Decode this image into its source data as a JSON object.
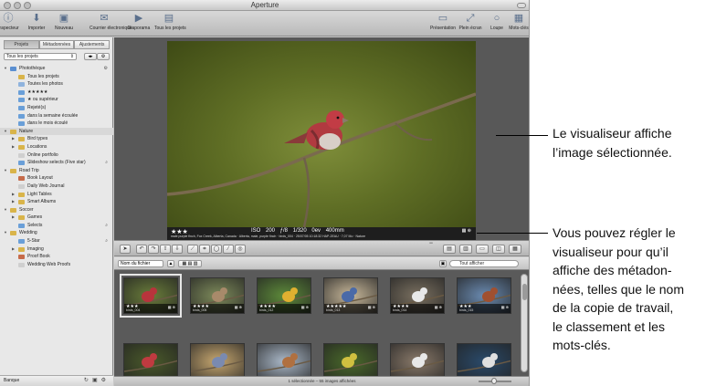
{
  "window": {
    "title": "Aperture"
  },
  "toolbar": {
    "left": [
      {
        "label": "Inspecteur",
        "icon": "inspector-icon",
        "glyph": "ⓘ"
      },
      {
        "label": "Importer",
        "icon": "import-icon",
        "glyph": "⬇"
      },
      {
        "label": "Nouveau",
        "icon": "new-icon",
        "glyph": "▣"
      },
      {
        "label": "Courrier électronique",
        "icon": "email-icon",
        "glyph": "✉"
      },
      {
        "label": "Diaporama",
        "icon": "slideshow-icon",
        "glyph": "▶"
      },
      {
        "label": "Tous les projets",
        "icon": "all-projects-icon",
        "glyph": "▤"
      }
    ],
    "right": [
      {
        "label": "Présentation",
        "icon": "viewer-mode-icon",
        "glyph": "▭"
      },
      {
        "label": "Plein écran",
        "icon": "fullscreen-icon",
        "glyph": "⤢"
      },
      {
        "label": "Loupe",
        "icon": "loupe-icon",
        "glyph": "○"
      },
      {
        "label": "Mots-clés",
        "icon": "keywords-icon",
        "glyph": "▦"
      }
    ]
  },
  "sidebar": {
    "tabs": [
      "Projets",
      "Métadonnées",
      "Ajustements"
    ],
    "filter": "Tous les projets",
    "tree": [
      {
        "label": "Photothèque",
        "level": 0,
        "tri": "▼",
        "color": "#5b8fd1",
        "ext": "⚙"
      },
      {
        "label": "Tous les projets",
        "level": 1,
        "color": "#d9b44a"
      },
      {
        "label": "Toutes les photos",
        "level": 1,
        "color": "#8fb3dd"
      },
      {
        "label": "★★★★★",
        "level": 1,
        "color": "#6a9fd8"
      },
      {
        "label": "★ ou supérieur",
        "level": 1,
        "color": "#6a9fd8"
      },
      {
        "label": "Rejeté(s)",
        "level": 1,
        "color": "#6a9fd8"
      },
      {
        "label": "dans la semaine écoulée",
        "level": 1,
        "color": "#6a9fd8"
      },
      {
        "label": "dans le mois écoulé",
        "level": 1,
        "color": "#6a9fd8"
      },
      {
        "label": "Nature",
        "level": 0,
        "tri": "▼",
        "color": "#d9b44a",
        "selected": true
      },
      {
        "label": "Bird types",
        "level": 1,
        "tri": "▶",
        "color": "#d9b44a"
      },
      {
        "label": "Locations",
        "level": 1,
        "tri": "▶",
        "color": "#d9b44a"
      },
      {
        "label": "Online portfolio",
        "level": 1,
        "color": "#cfcfcf"
      },
      {
        "label": "Slideshow selects (Five star)",
        "level": 1,
        "color": "#6a9fd8",
        "ext": "🔍"
      },
      {
        "label": "Road Trip",
        "level": 0,
        "tri": "▼",
        "color": "#d9b44a"
      },
      {
        "label": "Book Layout",
        "level": 1,
        "color": "#c66b4a"
      },
      {
        "label": "Daily Web Journal",
        "level": 1,
        "color": "#cfcfcf"
      },
      {
        "label": "Light Tables",
        "level": 1,
        "tri": "▶",
        "color": "#d9b44a"
      },
      {
        "label": "Smart Albums",
        "level": 1,
        "tri": "▶",
        "color": "#d9b44a"
      },
      {
        "label": "Soccer",
        "level": 0,
        "tri": "▼",
        "color": "#d9b44a"
      },
      {
        "label": "Games",
        "level": 1,
        "tri": "▶",
        "color": "#d9b44a"
      },
      {
        "label": "Selects",
        "level": 1,
        "color": "#6a9fd8",
        "ext": "🔍"
      },
      {
        "label": "Wedding",
        "level": 0,
        "tri": "▼",
        "color": "#d9b44a"
      },
      {
        "label": "5-Star",
        "level": 1,
        "color": "#6a9fd8",
        "ext": "🔍"
      },
      {
        "label": "Imaging",
        "level": 1,
        "tri": "▶",
        "color": "#d9b44a"
      },
      {
        "label": "Proof Book",
        "level": 1,
        "color": "#c66b4a"
      },
      {
        "label": "Wedding Web Proofs",
        "level": 1,
        "color": "#cfcfcf"
      }
    ],
    "bottom_label": "Banque"
  },
  "viewer": {
    "stars": "★★★",
    "exif": "ISO 200   ƒ/8   1/320   0ev   400mm",
    "metaline": "male purple finch, Fox Creek, Alberta, Canada · Alberta, male, purple finch · birds_004 · 25/07/05 10:18:32 HAP-2EAU · 7,07 Mo · Nature"
  },
  "browser": {
    "sort": "Nom du fichier",
    "search_placeholder": "Tout afficher",
    "thumbnails": [
      {
        "name": "birds_004",
        "stars": "★★★",
        "bg": "#6a7d3a",
        "bird": "#b8343c",
        "selected": true
      },
      {
        "name": "birds_005",
        "stars": "★★★★",
        "bg": "#7d8a5a",
        "bird": "#a88a6a"
      },
      {
        "name": "birds_012",
        "stars": "★★★★",
        "bg": "#5d8a3a",
        "bird": "#e0b030"
      },
      {
        "name": "birds_013",
        "stars": "★★★★★",
        "bg": "#c8b89a",
        "bird": "#4a6aa8"
      },
      {
        "name": "birds_014",
        "stars": "★★★★",
        "bg": "#7a7060",
        "bird": "#e8e8e8"
      },
      {
        "name": "birds_015",
        "stars": "★★★",
        "bg": "#6a8ab0",
        "bird": "#a05030"
      },
      {
        "name": "",
        "stars": "",
        "bg": "#4a5a2a",
        "bird": "#c03a40"
      },
      {
        "name": "",
        "stars": "",
        "bg": "#c8a870",
        "bird": "#7a8ab0"
      },
      {
        "name": "",
        "stars": "",
        "bg": "#aab8c8",
        "bird": "#b07040"
      },
      {
        "name": "",
        "stars": "",
        "bg": "#4a6a2a",
        "bird": "#d0c040"
      },
      {
        "name": "",
        "stars": "",
        "bg": "#8a7a6a",
        "bird": "#e8e8e8"
      },
      {
        "name": "",
        "stars": "",
        "bg": "#2a4a6a",
        "bird": "#e0e0e0"
      }
    ],
    "status": "1 sélectionnée – 55 images affichées"
  },
  "callouts": [
    {
      "text": "Le visualiseur affiche\nl’image sélectionnée."
    },
    {
      "text": "Vous pouvez régler le\nvisualiseur pour qu’il\naffiche des métadon-\nnées, telles que le nom\nde la copie de travail,\nle classement et les\nmots-clés."
    }
  ]
}
